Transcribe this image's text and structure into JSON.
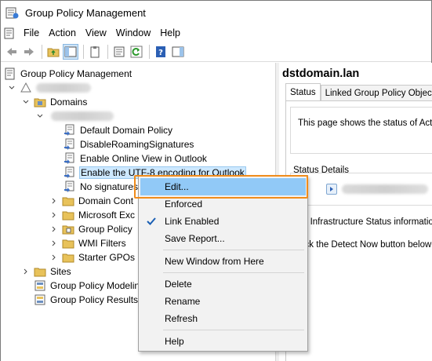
{
  "window": {
    "title": "Group Policy Management"
  },
  "menu": [
    "File",
    "Action",
    "View",
    "Window",
    "Help"
  ],
  "tree": {
    "root": "Group Policy Management",
    "domains": "Domains",
    "gpos": [
      "Default Domain Policy",
      "DisableRoamingSignatures",
      "Enable Online View in Outlook",
      "Enable the UTF-8 encoding for Outlook",
      "No signatures"
    ],
    "ous": [
      "Domain Cont",
      "Microsoft Exc",
      "Group Policy",
      "WMI Filters",
      "Starter GPOs"
    ],
    "sites": "Sites",
    "modeling": "Group Policy Modeling",
    "results": "Group Policy Results"
  },
  "right": {
    "title": "dstdomain.lan",
    "tabs": [
      "Status",
      "Linked Group Policy Objects"
    ],
    "status_text": "This page shows the status of Active",
    "details_label": "Status Details",
    "info1": "o Infrastructure Status information",
    "info2": "ick the Detect Now button below"
  },
  "context_menu": {
    "edit": "Edit...",
    "enforced": "Enforced",
    "link_enabled": "Link Enabled",
    "save_report": "Save Report...",
    "new_window": "New Window from Here",
    "delete": "Delete",
    "rename": "Rename",
    "refresh": "Refresh",
    "help": "Help"
  },
  "colors": {
    "hover": "#91c9f7",
    "focus_outline": "#f08c1c",
    "selection": "#cde8ff",
    "check": "#1a5fb4"
  }
}
